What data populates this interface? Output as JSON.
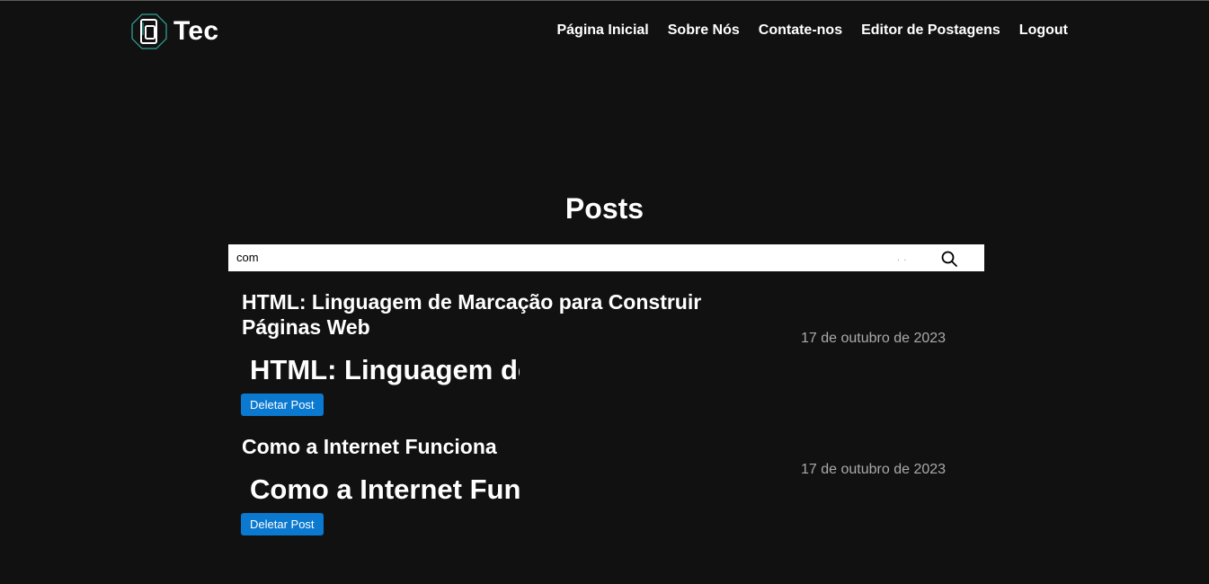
{
  "header": {
    "logo_text": "Tec",
    "nav": [
      {
        "label": "Página Inicial"
      },
      {
        "label": "Sobre Nós"
      },
      {
        "label": "Contate-nos"
      },
      {
        "label": "Editor de Postagens"
      },
      {
        "label": "Logout"
      }
    ]
  },
  "main": {
    "title": "Posts",
    "search": {
      "value": "com",
      "dots": ". ."
    },
    "posts": [
      {
        "title": "HTML: Linguagem de Marcação para Construir Páginas Web",
        "date": "17 de outubro de 2023",
        "preview": "HTML: Linguagem de Marcação para Construir Páginas Web",
        "delete_label": "Deletar Post"
      },
      {
        "title": "Como a Internet Funciona",
        "date": "17 de outubro de 2023",
        "preview": "Como a Internet Funciona",
        "delete_label": "Deletar Post"
      }
    ]
  },
  "colors": {
    "background": "#111111",
    "accent_button": "#0b79d0",
    "date_text": "#aaaaaa",
    "logo_accent": "#2fa89a"
  }
}
